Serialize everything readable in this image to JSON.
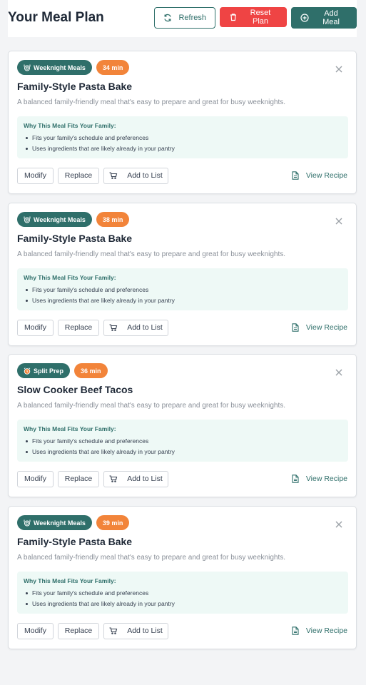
{
  "header": {
    "title": "Your Meal Plan",
    "refresh_label": "Refresh",
    "reset_label": "Reset Plan",
    "add_label": "Add Meal"
  },
  "colors": {
    "primary": "#2f6f6a",
    "danger": "#ef4444",
    "time_badge": "#f2843a",
    "why_bg": "#eef9f6"
  },
  "meals": [
    {
      "type_label": "Weeknight Meals",
      "type_icon": "plate-icon",
      "time": "34 min",
      "title": "Family-Style Pasta Bake",
      "description": "A balanced family-friendly meal that's easy to prepare and great for busy weeknights.",
      "why_title": "Why This Meal Fits Your Family:",
      "reasons": [
        "Fits your family's schedule and preferences",
        "Uses ingredients that are likely already in your pantry"
      ],
      "modify": "Modify",
      "replace": "Replace",
      "add_to_list": "Add to List",
      "view_recipe": "View Recipe"
    },
    {
      "type_label": "Weeknight Meals",
      "type_icon": "plate-icon",
      "time": "38 min",
      "title": "Family-Style Pasta Bake",
      "description": "A balanced family-friendly meal that's easy to prepare and great for busy weeknights.",
      "why_title": "Why This Meal Fits Your Family:",
      "reasons": [
        "Fits your family's schedule and preferences",
        "Uses ingredients that are likely already in your pantry"
      ],
      "modify": "Modify",
      "replace": "Replace",
      "add_to_list": "Add to List",
      "view_recipe": "View Recipe"
    },
    {
      "type_label": "Split Prep",
      "type_icon": "alarm-clock-icon",
      "time": "36 min",
      "title": "Slow Cooker Beef Tacos",
      "description": "A balanced family-friendly meal that's easy to prepare and great for busy weeknights.",
      "why_title": "Why This Meal Fits Your Family:",
      "reasons": [
        "Fits your family's schedule and preferences",
        "Uses ingredients that are likely already in your pantry"
      ],
      "modify": "Modify",
      "replace": "Replace",
      "add_to_list": "Add to List",
      "view_recipe": "View Recipe"
    },
    {
      "type_label": "Weeknight Meals",
      "type_icon": "plate-icon",
      "time": "39 min",
      "title": "Family-Style Pasta Bake",
      "description": "A balanced family-friendly meal that's easy to prepare and great for busy weeknights.",
      "why_title": "Why This Meal Fits Your Family:",
      "reasons": [
        "Fits your family's schedule and preferences",
        "Uses ingredients that are likely already in your pantry"
      ],
      "modify": "Modify",
      "replace": "Replace",
      "add_to_list": "Add to List",
      "view_recipe": "View Recipe"
    }
  ]
}
